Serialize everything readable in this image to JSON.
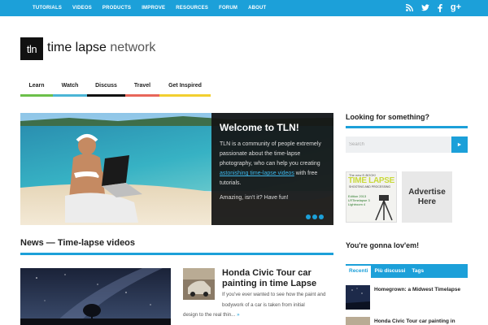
{
  "topnav": {
    "items": [
      "TUTORIALS",
      "VIDEOS",
      "PRODUCTS",
      "IMPROVE",
      "RESOURCES",
      "FORUM",
      "ABOUT"
    ],
    "social": [
      "rss-icon",
      "twitter-icon",
      "facebook-icon",
      "google-plus-icon"
    ],
    "social_gplus": "g+"
  },
  "logo": {
    "mark": "tln",
    "name_bold": "time lapse",
    "name_light": " network"
  },
  "categories": [
    {
      "label": "Learn",
      "color": "#6cc04a"
    },
    {
      "label": "Watch",
      "color": "#4bb5d6"
    },
    {
      "label": "Discuss",
      "color": "#111111"
    },
    {
      "label": "Travel",
      "color": "#e8665a"
    },
    {
      "label": "Get Inspired",
      "color": "#f2cf2f"
    }
  ],
  "slider": {
    "title": "Welcome to TLN!",
    "text_before": "TLN is a community of people extremely passionate about the time-lapse photography, who can help you creating ",
    "link": "astonishing time-lapse videos",
    "text_after": " with free tutorials.",
    "tagline": "Amazing, isn't it? Have fun!"
  },
  "news": {
    "title": "News — Time-lapse videos",
    "post_title": "Honda Civic Tour car painting in time Lapse",
    "excerpt_a": "If you've ever wanted to see how the paint and bodywork of a car is taken from initial",
    "excerpt_b": "design to the real thin...",
    "more": "»"
  },
  "sidebar": {
    "search_title": "Looking for something?",
    "search_placeholder": "Search",
    "search_button": "►",
    "ebook": {
      "line1": "The new E-BOOK!",
      "line2": "TIME LAPSE",
      "line3": "SHOOTING AND PROCESSING",
      "line4": "Edition 2013 LRTimelapse 3 Lightroom 4"
    },
    "advert": "Advertise Here",
    "love_title": "You're gonna lov'em!",
    "tabs": [
      "Recenti",
      "Più discussi",
      "Tags"
    ],
    "posts": [
      "Homegrown: a Midwest Timelapse",
      "Honda Civic Tour car painting in"
    ]
  },
  "colors": {
    "accent": "#1ca0d9"
  }
}
